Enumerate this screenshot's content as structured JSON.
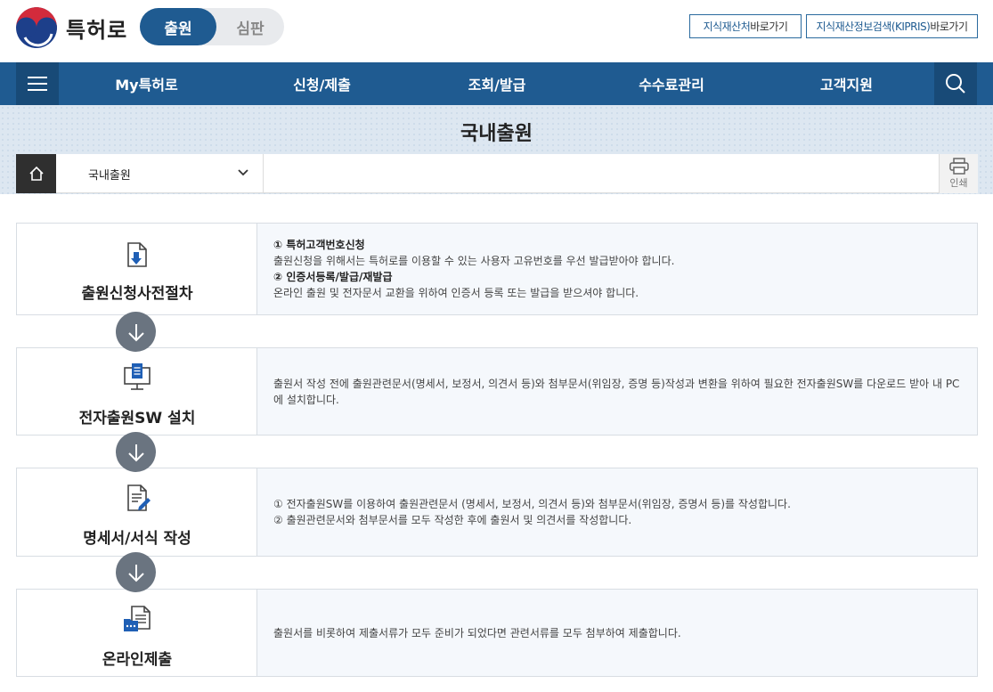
{
  "header": {
    "brand": "특허로",
    "toggle": {
      "active": "출원",
      "inactive": "심판"
    },
    "quick_links": [
      {
        "highlight": "지식재산처",
        "rest": " 바로가기"
      },
      {
        "highlight": "지식재산정보검색(KIPRIS)",
        "rest": " 바로가기"
      }
    ]
  },
  "nav": {
    "items": [
      "My특허로",
      "신청/제출",
      "조회/발급",
      "수수료관리",
      "고객지원"
    ]
  },
  "page": {
    "title": "국내출원",
    "breadcrumb_select": "국내출원",
    "print_label": "인쇄"
  },
  "steps": [
    {
      "title": "출원신청사전절차",
      "icon": "document-download-icon",
      "lines": [
        {
          "bold": true,
          "text": "① 특허고객번호신청"
        },
        {
          "bold": false,
          "text": "출원신청을 위해서는 특허로를 이용할 수 있는 사용자 고유번호를 우선 발급받아야 합니다."
        },
        {
          "bold": true,
          "text": "② 인증서등록/발급/재발급"
        },
        {
          "bold": false,
          "text": "온라인 출원 및 전자문서 교환을 위하여 인증서 등록 또는 발급을 받으셔야 합니다."
        }
      ]
    },
    {
      "title": "전자출원SW 설치",
      "icon": "monitor-document-icon",
      "lines": [
        {
          "bold": false,
          "text": "출원서 작성 전에 출원관련문서(명세서, 보정서, 의견서 등)와 첨부문서(위임장, 증명 등)작성과 변환을 위하여 필요한 전자출원SW를 다운로드 받아 내 PC에 설치합니다."
        }
      ]
    },
    {
      "title": "명세서/서식 작성",
      "icon": "document-edit-icon",
      "lines": [
        {
          "bold": false,
          "text": "① 전자출원SW를 이용하여 출원관련문서 (명세서, 보정서, 의견서 등)와 첨부문서(위임장, 증명서 등)를 작성합니다."
        },
        {
          "bold": false,
          "text": "② 출원관련문서와 첨부문서를 모두 작성한 후에 출원서 및 의견서를 작성합니다."
        }
      ]
    },
    {
      "title": "온라인제출",
      "icon": "folder-document-icon",
      "lines": [
        {
          "bold": false,
          "text": "출원서를 비롯하여 제출서류가 모두 준비가 되었다면 관련서류를 모두 첨부하여 제출합니다."
        }
      ]
    }
  ]
}
